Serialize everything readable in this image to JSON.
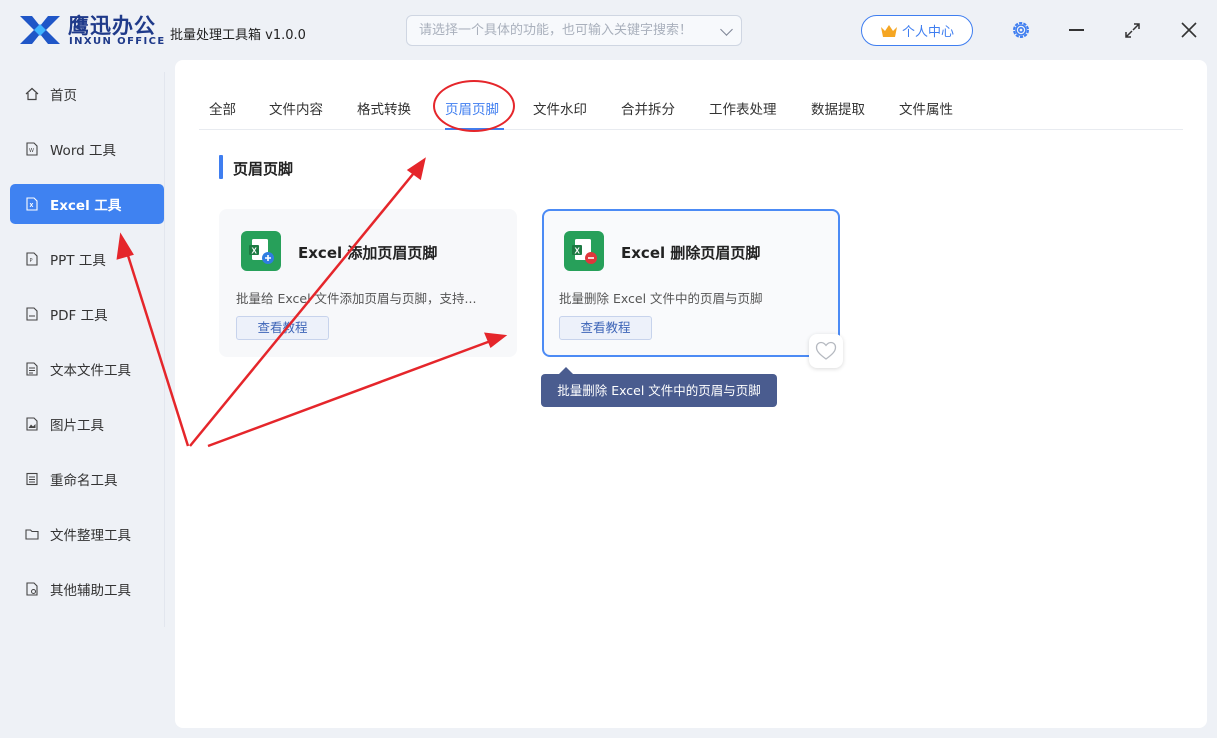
{
  "brand": {
    "name_cn": "鹰迅办公",
    "name_en": "INXUN OFFICE"
  },
  "app_title": "批量处理工具箱 v1.0.0",
  "search": {
    "placeholder": "请选择一个具体的功能，也可输入关键字搜索！"
  },
  "user_center": {
    "label": "个人中心"
  },
  "sidebar": {
    "items": [
      {
        "label": "首页",
        "icon": "home-icon"
      },
      {
        "label": "Word 工具",
        "icon": "word-file-icon"
      },
      {
        "label": "Excel 工具",
        "icon": "excel-file-icon",
        "active": true
      },
      {
        "label": "PPT 工具",
        "icon": "ppt-file-icon"
      },
      {
        "label": "PDF 工具",
        "icon": "pdf-file-icon"
      },
      {
        "label": "文本文件工具",
        "icon": "text-file-icon"
      },
      {
        "label": "图片工具",
        "icon": "image-file-icon"
      },
      {
        "label": "重命名工具",
        "icon": "rename-icon"
      },
      {
        "label": "文件整理工具",
        "icon": "folder-icon"
      },
      {
        "label": "其他辅助工具",
        "icon": "tools-icon"
      }
    ]
  },
  "tabs": [
    {
      "label": "全部"
    },
    {
      "label": "文件内容"
    },
    {
      "label": "格式转换"
    },
    {
      "label": "页眉页脚",
      "active": true
    },
    {
      "label": "文件水印"
    },
    {
      "label": "合并拆分"
    },
    {
      "label": "工作表处理"
    },
    {
      "label": "数据提取"
    },
    {
      "label": "文件属性"
    }
  ],
  "section": {
    "title": "页眉页脚"
  },
  "cards": [
    {
      "title": "Excel 添加页眉页脚",
      "description": "批量给 Excel 文件添加页眉与页脚，支持...",
      "button": "查看教程",
      "icon": "excel-add-icon"
    },
    {
      "title": "Excel 删除页眉页脚",
      "description": "批量删除 Excel 文件中的页眉与页脚",
      "button": "查看教程",
      "icon": "excel-remove-icon",
      "selected": true
    }
  ],
  "tooltip": "批量删除 Excel 文件中的页眉与页脚",
  "colors": {
    "accent": "#3f82f1",
    "annotation": "#e5262b",
    "excel_green": "#27a05a"
  }
}
